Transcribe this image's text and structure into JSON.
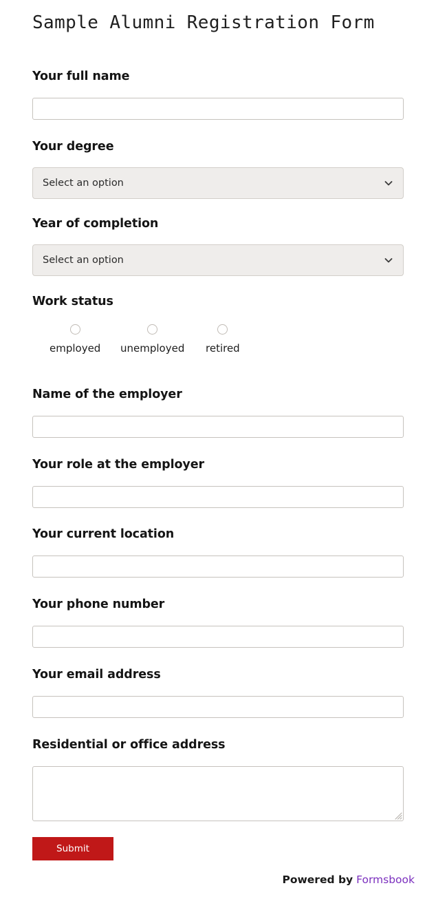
{
  "title": "Sample Alumni Registration Form",
  "fields": {
    "full_name": {
      "label": "Your full name",
      "value": "",
      "placeholder": ""
    },
    "degree": {
      "label": "Your degree",
      "selected": "Select an option"
    },
    "year_of_completion": {
      "label": "Year of completion",
      "selected": "Select an option"
    },
    "work_status": {
      "label": "Work status",
      "options": [
        {
          "label": "employed",
          "selected": false
        },
        {
          "label": "unemployed",
          "selected": false
        },
        {
          "label": "retired",
          "selected": false
        }
      ]
    },
    "employer_name": {
      "label": "Name of the employer",
      "value": "",
      "placeholder": ""
    },
    "role": {
      "label": "Your role at the employer",
      "value": "",
      "placeholder": ""
    },
    "location": {
      "label": "Your current location",
      "value": "",
      "placeholder": ""
    },
    "phone": {
      "label": "Your phone number",
      "value": "",
      "placeholder": ""
    },
    "email": {
      "label": "Your email address",
      "value": "",
      "placeholder": ""
    },
    "address": {
      "label": "Residential or office address",
      "value": "",
      "placeholder": ""
    }
  },
  "submit": {
    "label": "Submit"
  },
  "footer": {
    "text": "Powered by",
    "link_label": "Formsbook"
  },
  "colors": {
    "submit_background": "#c01818",
    "link": "#7b2fbe",
    "select_background": "#efedeb",
    "input_border": "#c6c2bd"
  }
}
